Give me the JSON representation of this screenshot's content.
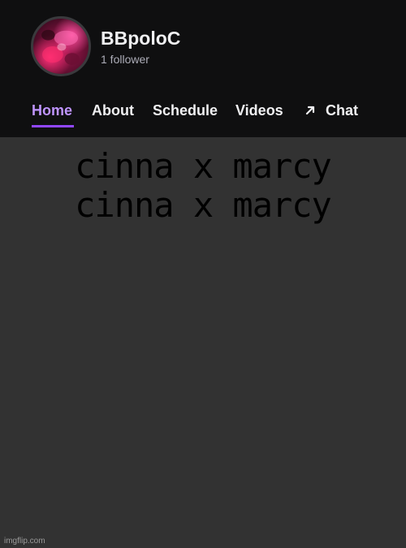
{
  "channel": {
    "name": "BBpoloC",
    "followers": "1 follower"
  },
  "tabs": [
    {
      "label": "Home",
      "active": true
    },
    {
      "label": "About",
      "active": false
    },
    {
      "label": "Schedule",
      "active": false
    },
    {
      "label": "Videos",
      "active": false
    },
    {
      "label": "Chat",
      "active": false,
      "icon": "arrow-up-right-icon"
    }
  ],
  "caption": {
    "line1": "cinna x marcy",
    "line2": "cinna x marcy"
  },
  "watermark": "imgflip.com",
  "colors": {
    "header_bg": "#0f0f10",
    "body_bg": "#323232",
    "accent": "#9147ff",
    "active_tab_text": "#bf94ff"
  }
}
